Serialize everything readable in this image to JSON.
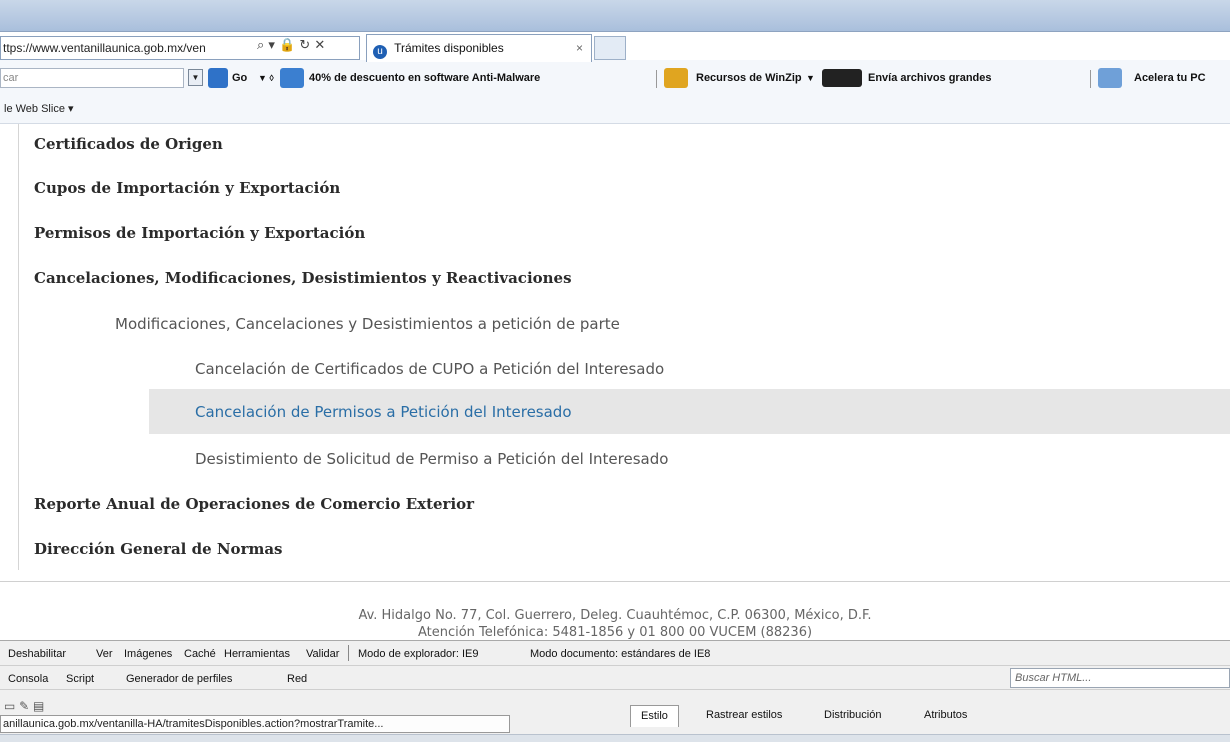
{
  "browser": {
    "address_url": "ttps://www.ventanillaunica.gob.mx/ven",
    "address_buttons": "⌕ ▾ 🔒 ↻ ✕",
    "tab_title": "Trámites disponibles",
    "tab_icon_letter": "u",
    "tab_close": "×"
  },
  "toolbar": {
    "search_placeholder": "car",
    "go_label": "Go",
    "dropdown_glyph": "▼",
    "ad_antimalware": "40% de descuento en software Anti-Malware",
    "winzip": "Recursos de WinZip",
    "send_label": "Envía archivos grandes",
    "acelera": "Acelera tu PC"
  },
  "favorites": {
    "web_slice": "le Web Slice ▾"
  },
  "menu": {
    "items": [
      "Certificados de Origen",
      "Cupos de Importación y Exportación",
      "Permisos de Importación y Exportación",
      "Cancelaciones, Modificaciones, Desistimientos y Reactivaciones"
    ],
    "sub_header": "Modificaciones, Cancelaciones y Desistimientos a petición de parte",
    "sub_items": [
      "Cancelación de Certificados de CUPO a Petición del Interesado",
      "Cancelación de Permisos a Petición del Interesado",
      "Desistimiento de Solicitud de Permiso a Petición del Interesado"
    ],
    "tail_items": [
      "Reporte Anual de Operaciones de Comercio Exterior",
      "Dirección General de Normas"
    ]
  },
  "footer": {
    "address": "Av. Hidalgo No. 77, Col. Guerrero, Deleg. Cuauhtémoc, C.P. 06300, México, D.F.",
    "phone": "Atención Telefónica: 5481-1856 y 01 800 00 VUCEM (88236)"
  },
  "devtools": {
    "menu": [
      "Deshabilitar",
      "Ver",
      "Imágenes",
      "Caché",
      "Herramientas",
      "Validar"
    ],
    "browser_mode": "Modo de explorador: IE9",
    "doc_mode": "Modo documento: estándares de IE8",
    "tabs": [
      "Consola",
      "Script",
      "Generador de perfiles",
      "Red"
    ],
    "search_placeholder": "Buscar HTML...",
    "status_url": "anillaunica.gob.mx/ventanilla-HA/tramitesDisponibles.action?mostrarTramite...",
    "side_tabs": [
      "Estilo",
      "Rastrear estilos",
      "Distribución",
      "Atributos"
    ]
  },
  "colors": {
    "active_link": "#2a6ea6",
    "highlight_row": "#e6e6e6"
  }
}
